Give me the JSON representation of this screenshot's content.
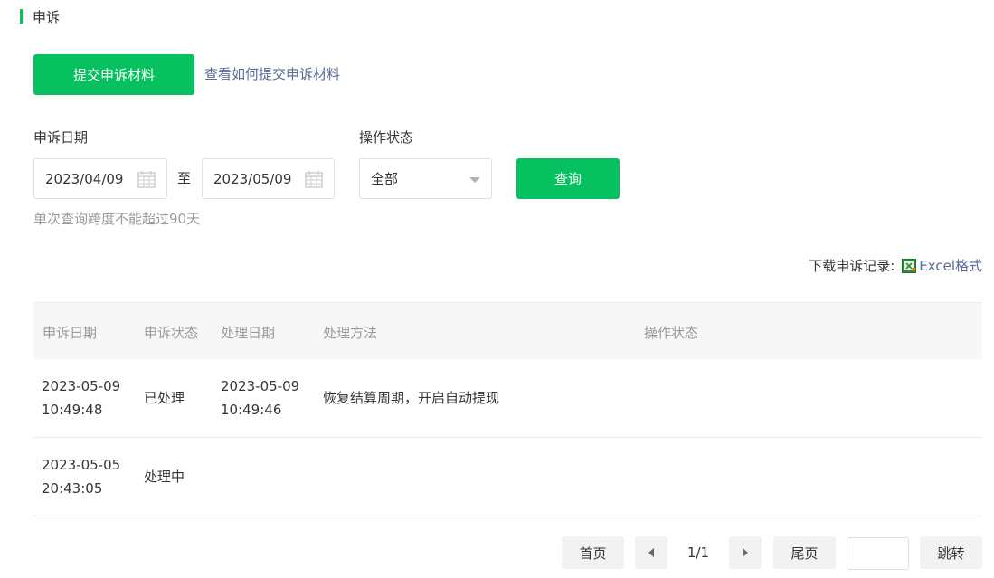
{
  "section": {
    "title": "申诉"
  },
  "actions": {
    "submit_label": "提交申诉材料",
    "howto_link": "查看如何提交申诉材料"
  },
  "filters": {
    "date_label": "申诉日期",
    "start_date": "2023/04/09",
    "to_label": "至",
    "end_date": "2023/05/09",
    "status_label": "操作状态",
    "status_value": "全部",
    "query_label": "查询",
    "hint": "单次查询跨度不能超过90天"
  },
  "download": {
    "label": "下载申诉记录:",
    "link": "Excel格式",
    "icon": "excel-icon"
  },
  "table": {
    "headers": [
      "申诉日期",
      "申诉状态",
      "处理日期",
      "处理方法",
      "操作状态"
    ],
    "rows": [
      {
        "appeal_date": "2023-05-09 10:49:48",
        "status": "已处理",
        "process_date": "2023-05-09 10:49:46",
        "method": "恢复结算周期，开启自动提现",
        "op_status": ""
      },
      {
        "appeal_date": "2023-05-05 20:43:05",
        "status": "处理中",
        "process_date": "",
        "method": "",
        "op_status": ""
      }
    ]
  },
  "pager": {
    "first": "首页",
    "page_info": "1/1",
    "last": "尾页",
    "jump": "跳转",
    "jump_value": ""
  },
  "colors": {
    "accent": "#07c160",
    "link": "#576b95"
  }
}
